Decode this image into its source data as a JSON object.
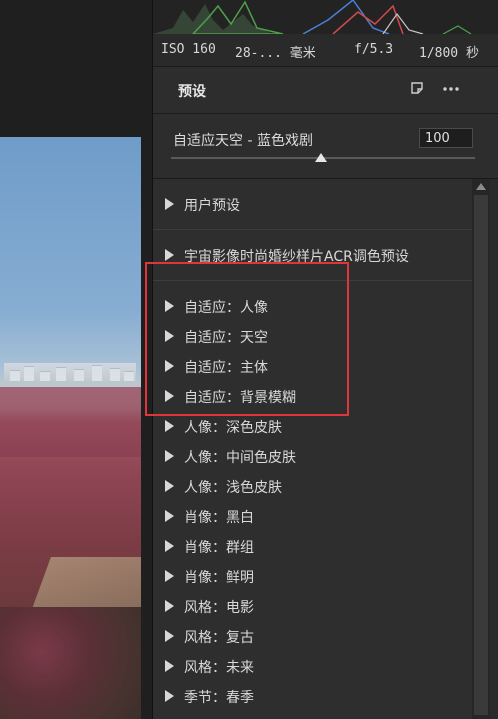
{
  "exif": {
    "iso": "ISO 160",
    "focal": "28-... 毫米",
    "aperture": "f/5.3",
    "shutter": "1/800 秒"
  },
  "presets_panel": {
    "title": "预设",
    "new_preset_icon": "new-preset-icon",
    "more_icon": "more-options-icon",
    "selected_preset": "自适应天空 - 蓝色戏剧",
    "amount": 100,
    "amount_slider_fraction": 0.5
  },
  "preset_groups": [
    {
      "label": "用户预设"
    },
    {
      "label": "宇宙影像时尚婚纱样片ACR调色预设"
    },
    {
      "label": "自适应：人像"
    },
    {
      "label": "自适应：天空"
    },
    {
      "label": "自适应：主体"
    },
    {
      "label": "自适应：背景模糊"
    },
    {
      "label": "人像：深色皮肤"
    },
    {
      "label": "人像：中间色皮肤"
    },
    {
      "label": "人像：浅色皮肤"
    },
    {
      "label": "肖像：黑白"
    },
    {
      "label": "肖像：群组"
    },
    {
      "label": "肖像：鲜明"
    },
    {
      "label": "风格：电影"
    },
    {
      "label": "风格：复古"
    },
    {
      "label": "风格：未来"
    },
    {
      "label": "季节：春季"
    }
  ],
  "colors": {
    "panel_bg": "#2c2c2c",
    "highlight": "#e0353b",
    "text": "#d9d9d9"
  }
}
